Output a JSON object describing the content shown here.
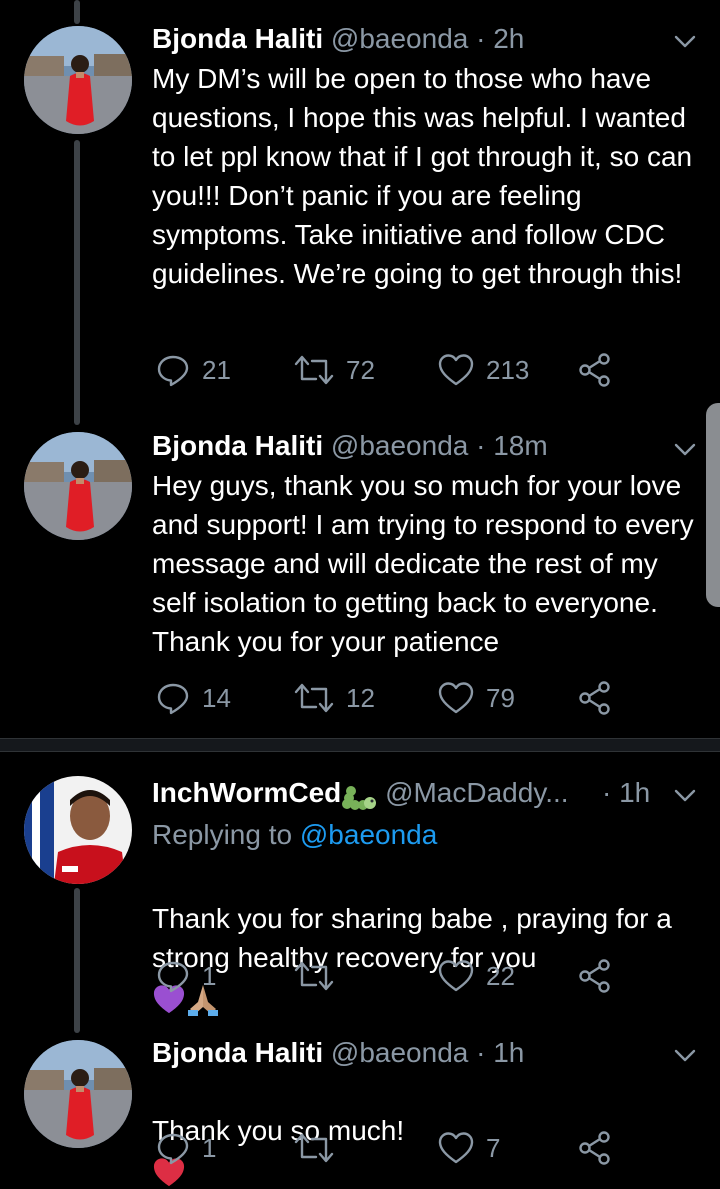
{
  "tweets": [
    {
      "name": "Bjonda Haliti",
      "handle": "@baeonda",
      "dot": "·",
      "time": "2h",
      "text": "My DM’s will be open to those who have questions, I hope this was helpful. I wanted to let ppl know that if I got through it, so can you!!! Don’t panic if you are feeling symptoms. Take initiative and follow CDC guidelines. We’re going to get through this!",
      "replies": "21",
      "retweets": "72",
      "likes": "213"
    },
    {
      "name": "Bjonda Haliti",
      "handle": "@baeonda",
      "dot": "·",
      "time": "18m",
      "text": "Hey guys, thank you so much for your love and support! I am trying to respond to every message and will dedicate the rest of my self isolation to getting back to everyone. Thank you for your patience",
      "replies": "14",
      "retweets": "12",
      "likes": "79"
    },
    {
      "name": "InchWormCed",
      "name_emoji": "caterpillar-emoji",
      "handle": "@MacDaddy...",
      "dot": "·",
      "time": "1h",
      "replying_prefix": "Replying to",
      "replying_to": "@baeonda",
      "text": "Thank you for sharing babe , praying for a strong healthy recovery for you",
      "text_emojis": [
        "purple-heart-emoji",
        "folded-hands-emoji"
      ],
      "replies": "1",
      "retweets": "",
      "likes": "22"
    },
    {
      "name": "Bjonda Haliti",
      "handle": "@baeonda",
      "dot": "·",
      "time": "1h",
      "text": "Thank you so much!",
      "text_emojis": [
        "red-heart-emoji"
      ],
      "replies": "1",
      "retweets": "",
      "likes": "7"
    }
  ],
  "colors": {
    "background": "#000000",
    "primary_text": "#ffffff",
    "secondary_text": "#8b98a5",
    "accent": "#1d9bf0",
    "thread_line": "#3d4247"
  },
  "icons": [
    "reply-icon",
    "retweet-icon",
    "like-icon",
    "share-icon",
    "chevron-down-icon"
  ]
}
